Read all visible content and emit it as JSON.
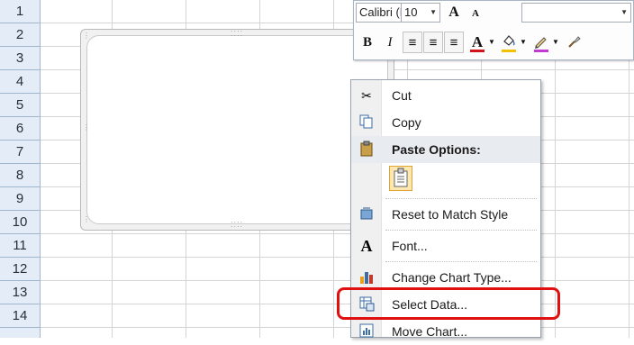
{
  "rows": [
    "1",
    "2",
    "3",
    "4",
    "5",
    "6",
    "7",
    "8",
    "9",
    "10",
    "11",
    "12",
    "13",
    "14"
  ],
  "mini_toolbar": {
    "font_name": "Calibri (E",
    "font_size": "10",
    "grow_font": "A",
    "shrink_font": "A",
    "bold": "B",
    "italic": "I",
    "align_left": "≡",
    "align_center": "≡",
    "align_right": "≡",
    "font_color": "A",
    "font_color_value": "#d0161a",
    "fill_color_value": "#f2c100",
    "outline_color_value": "#c23ad1"
  },
  "context_menu": {
    "cut": "Cut",
    "copy": "Copy",
    "paste_options": "Paste Options:",
    "reset_style": "Reset to Match Style",
    "font": "Font...",
    "change_chart_type": "Change Chart Type...",
    "select_data": "Select Data...",
    "move_chart": "Move Chart..."
  },
  "colors": {
    "highlight": "#e01010",
    "header_bg": "#e4ecf7"
  }
}
